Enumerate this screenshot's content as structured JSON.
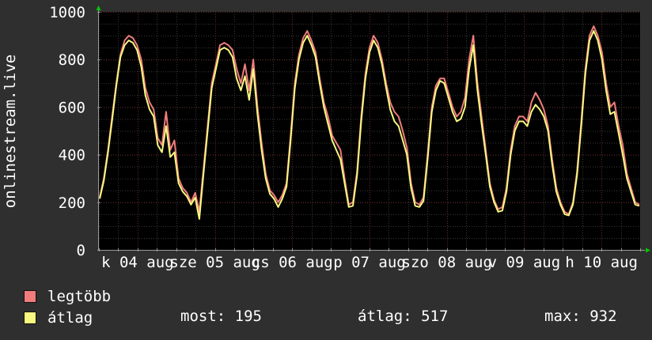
{
  "chart_data": {
    "type": "line",
    "ylabel": "onlinestream.live",
    "ylim": [
      0,
      1000
    ],
    "yticks": [
      0,
      200,
      400,
      600,
      800,
      1000
    ],
    "x_tick_labels": [
      "k 04 aug",
      "sze 05 aug",
      "cs 06 aug",
      "p 07 aug",
      "szo 08 aug",
      "v 09 aug",
      "h 10 aug"
    ],
    "grid": true,
    "series": [
      {
        "name": "legtöbb",
        "color": "#f07c7c",
        "values": [
          220,
          300,
          420,
          560,
          700,
          820,
          880,
          900,
          890,
          860,
          800,
          680,
          620,
          590,
          470,
          440,
          580,
          420,
          460,
          300,
          260,
          240,
          200,
          240,
          160,
          340,
          520,
          700,
          780,
          860,
          870,
          860,
          840,
          760,
          700,
          780,
          670,
          800,
          600,
          450,
          320,
          250,
          230,
          200,
          230,
          280,
          480,
          700,
          820,
          890,
          920,
          880,
          830,
          720,
          620,
          560,
          480,
          450,
          420,
          300,
          190,
          200,
          330,
          560,
          740,
          850,
          900,
          870,
          800,
          700,
          620,
          580,
          560,
          500,
          430,
          280,
          200,
          190,
          220,
          400,
          600,
          690,
          720,
          720,
          660,
          600,
          560,
          580,
          640,
          800,
          900,
          700,
          560,
          420,
          280,
          210,
          170,
          180,
          260,
          420,
          520,
          560,
          560,
          540,
          620,
          660,
          630,
          590,
          520,
          380,
          260,
          200,
          160,
          150,
          200,
          330,
          540,
          760,
          900,
          940,
          900,
          830,
          700,
          600,
          620,
          520,
          440,
          320,
          260,
          200,
          190
        ]
      },
      {
        "name": "átlag",
        "color": "#f8f880",
        "values": [
          215,
          290,
          410,
          545,
          690,
          810,
          860,
          880,
          870,
          840,
          770,
          650,
          590,
          560,
          440,
          410,
          520,
          390,
          410,
          280,
          245,
          225,
          190,
          220,
          130,
          320,
          500,
          680,
          760,
          840,
          850,
          840,
          810,
          720,
          670,
          730,
          630,
          760,
          570,
          420,
          300,
          235,
          215,
          180,
          215,
          265,
          460,
          680,
          800,
          870,
          900,
          860,
          810,
          700,
          600,
          530,
          460,
          420,
          380,
          280,
          180,
          185,
          315,
          540,
          720,
          830,
          880,
          850,
          780,
          680,
          590,
          540,
          520,
          460,
          400,
          260,
          185,
          180,
          205,
          380,
          580,
          670,
          710,
          700,
          640,
          580,
          540,
          550,
          600,
          760,
          860,
          670,
          530,
          400,
          265,
          200,
          160,
          165,
          245,
          400,
          500,
          540,
          540,
          520,
          580,
          610,
          590,
          560,
          500,
          360,
          245,
          190,
          150,
          145,
          190,
          315,
          520,
          740,
          880,
          920,
          880,
          800,
          670,
          570,
          580,
          490,
          400,
          300,
          245,
          190,
          185
        ]
      }
    ]
  },
  "legend": {
    "max_label": "legtöbb",
    "avg_label": "átlag",
    "max_color": "#f07c7c",
    "avg_color": "#f8f880"
  },
  "stats": {
    "current": "most: 195",
    "average": "átlag: 517",
    "maximum": "max: 932"
  }
}
